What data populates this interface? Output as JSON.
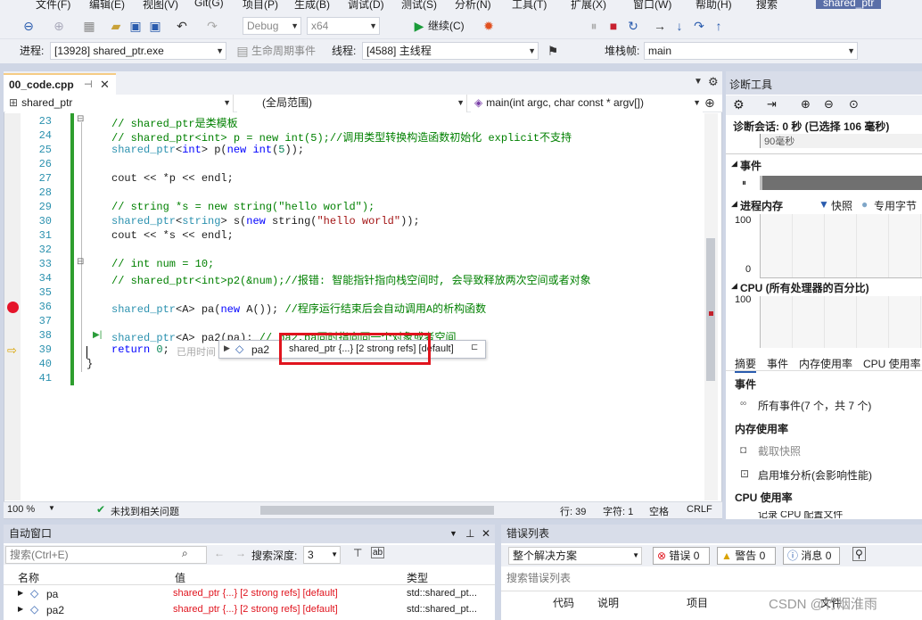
{
  "menu": {
    "items": [
      "文件(F)",
      "编辑(E)",
      "视图(V)",
      "Git(G)",
      "项目(P)",
      "生成(B)",
      "调试(D)",
      "测试(S)",
      "分析(N)",
      "工具(T)",
      "扩展(X)",
      "窗口(W)",
      "帮助(H)",
      "搜索",
      "shared_ptr"
    ]
  },
  "toolbar": {
    "config": "Debug",
    "platform": "x64",
    "continue_label": "继续(C)",
    "process_label": "进程:",
    "process_value": "[13928] shared_ptr.exe",
    "lifecycle_label": "生命周期事件",
    "thread_label": "线程:",
    "thread_value": "[4588] 主线程",
    "stack_label": "堆栈帧:",
    "stack_value": "main"
  },
  "editor": {
    "tab_label": "00_code.cpp",
    "nav_project": "shared_ptr",
    "nav_scope": "(全局范围)",
    "nav_func": "main(int argc, char const * argv[])",
    "lines": [
      {
        "n": "23",
        "code": "// shared_ptr是类模板"
      },
      {
        "n": "24",
        "code": "// shared_ptr<int> p = new int(5);//调用类型转换构造函数初始化 explicit不支持"
      },
      {
        "n": "25",
        "code": "shared_ptr<int> p(new int(5));"
      },
      {
        "n": "26",
        "code": ""
      },
      {
        "n": "27",
        "code": "cout << *p << endl;"
      },
      {
        "n": "28",
        "code": ""
      },
      {
        "n": "29",
        "code": "// string *s = new string(\"hello world\");"
      },
      {
        "n": "30",
        "code": "shared_ptr<string> s(new string(\"hello world\"));"
      },
      {
        "n": "31",
        "code": "cout << *s << endl;"
      },
      {
        "n": "32",
        "code": ""
      },
      {
        "n": "33",
        "code": "// int num = 10;"
      },
      {
        "n": "34",
        "code": "// shared_ptr<int>p2(&num);//报错: 智能指针指向栈空间时, 会导致释放两次空间或者对象"
      },
      {
        "n": "35",
        "code": ""
      },
      {
        "n": "36",
        "code": "shared_ptr<A> pa(new A()); //程序运行结束后会自动调用A的析构函数"
      },
      {
        "n": "37",
        "code": ""
      },
      {
        "n": "38",
        "code": "shared_ptr<A> pa2(pa); // pa2,pa同时指向同一个对象或者空间"
      },
      {
        "n": "39",
        "code": "return 0;"
      },
      {
        "n": "40",
        "code": "}"
      },
      {
        "n": "41",
        "code": ""
      }
    ],
    "elapsed_hint": "已用时间",
    "datatip_name": "pa2",
    "datatip_value": "shared_ptr {...} [2 strong refs] [default]",
    "zoom": "100 %",
    "status_msg": "未找到相关问题",
    "row": "行: 39",
    "col": "字符: 1",
    "indent": "空格",
    "eol": "CRLF"
  },
  "diag": {
    "title": "诊断工具",
    "session": "诊断会话: 0 秒 (已选择 106 毫秒)",
    "timeline": "90毫秒",
    "events_label": "事件",
    "mem_label": "进程内存",
    "snapshot_label": "快照",
    "private_label": "专用字节",
    "mem_max": "100",
    "mem_min": "0",
    "cpu_label": "CPU (所有处理器的百分比)",
    "cpu_max": "100",
    "tabs": [
      "摘要",
      "事件",
      "内存使用率",
      "CPU 使用率"
    ],
    "sec_events": "事件",
    "all_events": "所有事件(7 个，共 7 个)",
    "sec_mem": "内存使用率",
    "take_snapshot": "截取快照",
    "heap_analysis": "启用堆分析(会影响性能)",
    "sec_cpu": "CPU 使用率",
    "cpu_note": "记录 CPU 配置文件"
  },
  "auto": {
    "title": "自动窗口",
    "search_placeholder": "搜索(Ctrl+E)",
    "depth_label": "搜索深度:",
    "depth_value": "3",
    "col_name": "名称",
    "col_value": "值",
    "col_type": "类型",
    "rows": [
      {
        "name": "pa",
        "value": "shared_ptr {...} [2 strong refs] [default]",
        "type": "std::shared_pt..."
      },
      {
        "name": "pa2",
        "value": "shared_ptr {...} [2 strong refs] [default]",
        "type": "std::shared_pt..."
      }
    ]
  },
  "errors": {
    "title": "错误列表",
    "scope": "整个解决方案",
    "err": "错误 0",
    "warn": "警告 0",
    "msg": "消息 0",
    "search_placeholder": "搜索错误列表",
    "col_code": "代码",
    "col_desc": "说明",
    "col_proj": "项目",
    "col_file": "文件",
    "watermark": "CSDN @竹烟淮雨"
  }
}
